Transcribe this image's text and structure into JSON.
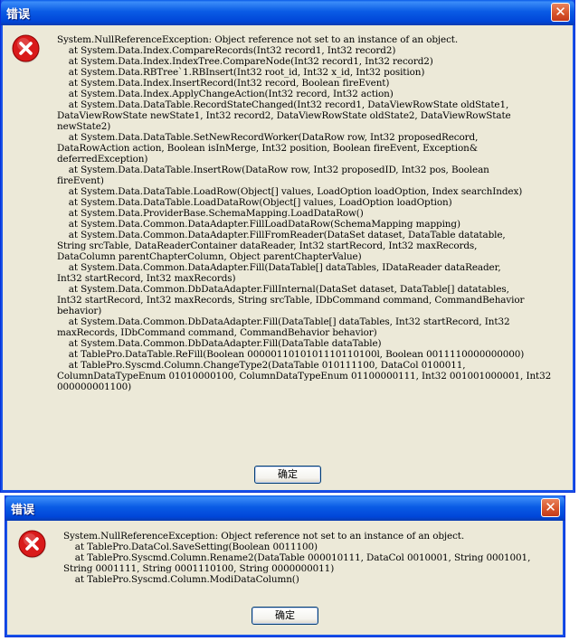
{
  "dialog1": {
    "title": "错误",
    "close_label": "✕",
    "message": "System.NullReferenceException: Object reference not set to an instance of an object.\n    at System.Data.Index.CompareRecords(Int32 record1, Int32 record2)\n    at System.Data.Index.IndexTree.CompareNode(Int32 record1, Int32 record2)\n    at System.Data.RBTree`1.RBInsert(Int32 root_id, Int32 x_id, Int32 position)\n    at System.Data.Index.InsertRecord(Int32 record, Boolean fireEvent)\n    at System.Data.Index.ApplyChangeAction(Int32 record, Int32 action)\n    at System.Data.DataTable.RecordStateChanged(Int32 record1, DataViewRowState oldState1,\nDataViewRowState newState1, Int32 record2, DataViewRowState oldState2, DataViewRowState\nnewState2)\n    at System.Data.DataTable.SetNewRecordWorker(DataRow row, Int32 proposedRecord,\nDataRowAction action, Boolean isInMerge, Int32 position, Boolean fireEvent, Exception&\ndeferredException)\n    at System.Data.DataTable.InsertRow(DataRow row, Int32 proposedID, Int32 pos, Boolean\nfireEvent)\n    at System.Data.DataTable.LoadRow(Object[] values, LoadOption loadOption, Index searchIndex)\n    at System.Data.DataTable.LoadDataRow(Object[] values, LoadOption loadOption)\n    at System.Data.ProviderBase.SchemaMapping.LoadDataRow()\n    at System.Data.Common.DataAdapter.FillLoadDataRow(SchemaMapping mapping)\n    at System.Data.Common.DataAdapter.FillFromReader(DataSet dataset, DataTable datatable,\nString srcTable, DataReaderContainer dataReader, Int32 startRecord, Int32 maxRecords,\nDataColumn parentChapterColumn, Object parentChapterValue)\n    at System.Data.Common.DataAdapter.Fill(DataTable[] dataTables, IDataReader dataReader,\nInt32 startRecord, Int32 maxRecords)\n    at System.Data.Common.DbDataAdapter.FillInternal(DataSet dataset, DataTable[] datatables,\nInt32 startRecord, Int32 maxRecords, String srcTable, IDbCommand command, CommandBehavior\nbehavior)\n    at System.Data.Common.DbDataAdapter.Fill(DataTable[] dataTables, Int32 startRecord, Int32\nmaxRecords, IDbCommand command, CommandBehavior behavior)\n    at System.Data.Common.DbDataAdapter.Fill(DataTable dataTable)\n    at TablePro.DataTable.ReFill(Boolean 0000011010101110110100l, Boolean 0011110000000000)\n    at TablePro.Syscmd.Column.ChangeType2(DataTable 010111100, DataCol 0100011,\nColumnDataTypeEnum 01010000100, ColumnDataTypeEnum 01100000111, Int32 001001000001, Int32\n000000001100)",
    "ok_label": "确定"
  },
  "dialog2": {
    "title": "错误",
    "close_label": "✕",
    "message": "System.NullReferenceException: Object reference not set to an instance of an object.\n    at TablePro.DataCol.SaveSetting(Boolean 0011100)\n    at TablePro.Syscmd.Column.Rename2(DataTable 000010111, DataCol 0010001, String 0001001,\nString 0001111, String 0001110100, String 0000000011)\n    at TablePro.Syscmd.Column.ModiDataColumn()",
    "ok_label": "确定"
  },
  "colors": {
    "title_bar": "#0054e3",
    "dialog_face": "#ece9d8",
    "close_button": "#d8562d",
    "error_icon": "#d91a1a"
  },
  "icons": {
    "error": "error-x-circle-icon",
    "close": "close-icon"
  }
}
